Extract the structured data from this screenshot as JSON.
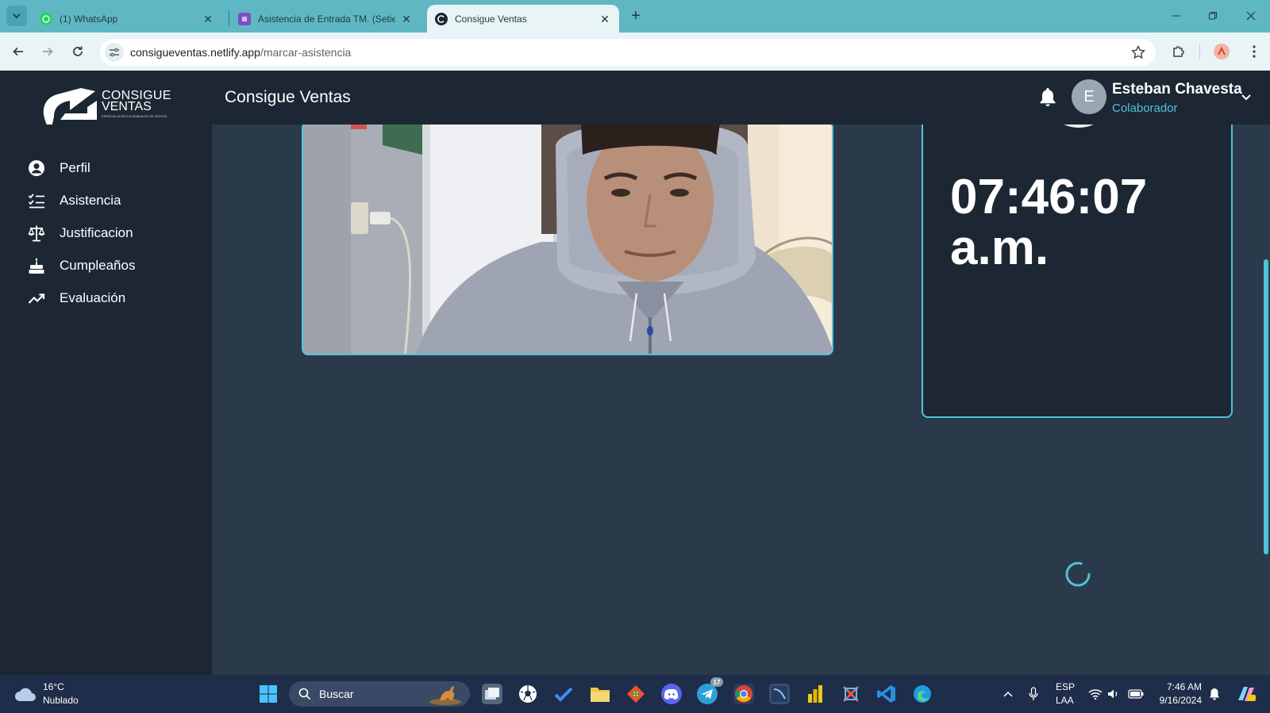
{
  "browser": {
    "tabs": [
      {
        "title": "(1) WhatsApp",
        "icon": "whatsapp-icon",
        "active": false
      },
      {
        "title": "Asistencia de Entrada TM. (Setie",
        "icon": "forms-icon",
        "active": false
      },
      {
        "title": "Consigue Ventas",
        "icon": "site-icon",
        "active": true
      }
    ],
    "url_host": "consigueventas.netlify.app",
    "url_path": "/marcar-asistencia"
  },
  "app": {
    "logo_line1": "CONSIGUE",
    "logo_line2": "VENTAS",
    "logo_tagline": "ESPECIALISTAS EN EMBUDOS DE VENTAS",
    "title": "Consigue Ventas",
    "user": {
      "initial": "E",
      "name": "Esteban Chavesta",
      "role": "Colaborador"
    }
  },
  "sidebar": {
    "items": [
      {
        "label": "Perfil",
        "icon": "user-circle-icon"
      },
      {
        "label": "Asistencia",
        "icon": "checklist-icon"
      },
      {
        "label": "Justificacion",
        "icon": "scale-icon"
      },
      {
        "label": "Cumpleaños",
        "icon": "cake-icon"
      },
      {
        "label": "Evaluación",
        "icon": "trend-up-icon"
      }
    ]
  },
  "main": {
    "clock_time": "07:46:07",
    "clock_period": "a.m."
  },
  "taskbar": {
    "weather_temp": "16°C",
    "weather_condition": "Nublado",
    "search_placeholder": "Buscar",
    "telegram_badge": "17",
    "lang_primary": "ESP",
    "lang_secondary": "LAA",
    "time": "7:46 AM",
    "date": "9/16/2024"
  },
  "colors": {
    "accent": "#4fc3d7",
    "sidebar_bg": "#1c2733",
    "content_bg": "#2b3a4a",
    "tab_strip": "#5fb7c4"
  }
}
